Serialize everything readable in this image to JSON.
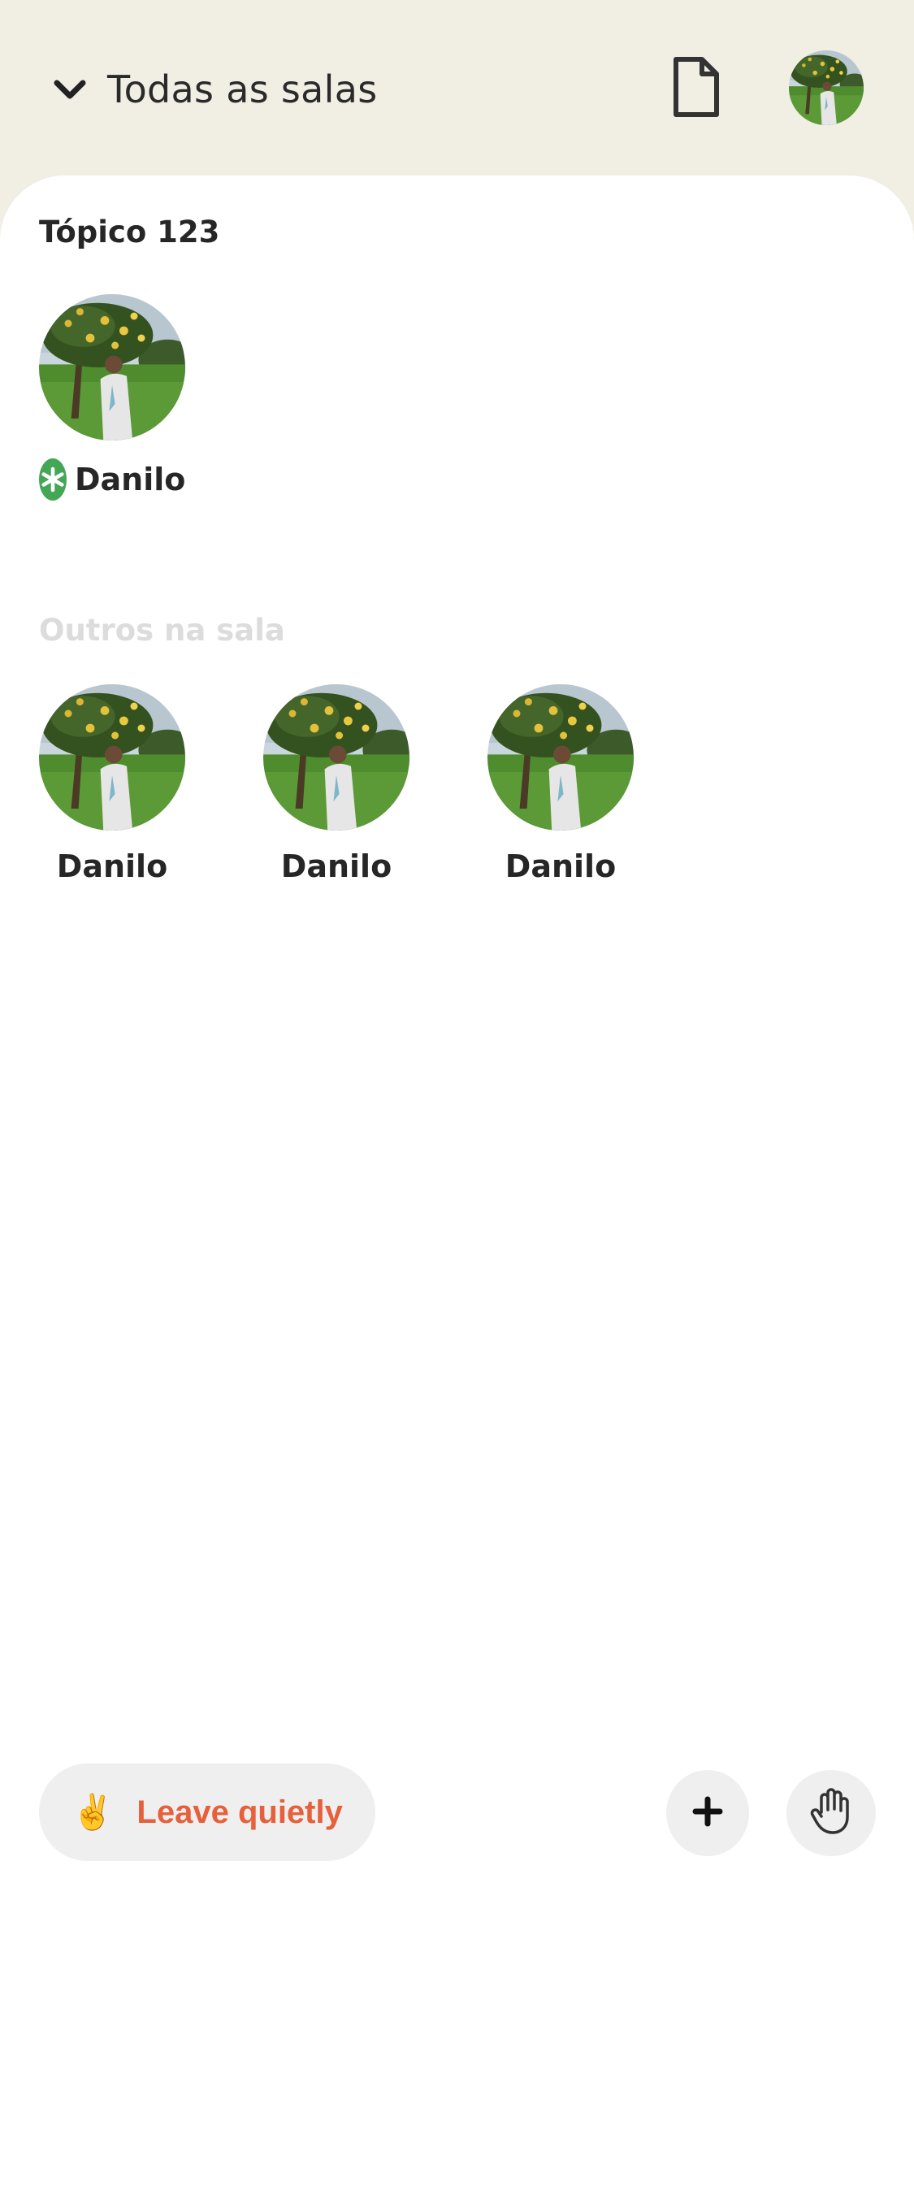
{
  "header": {
    "room_selector_label": "Todas as salas",
    "icons": [
      "chevron-down-icon",
      "document-icon",
      "profile-avatar"
    ]
  },
  "stage": {
    "title": "Tópico 123",
    "speakers": [
      {
        "name": "Danilo",
        "badge": "moderator-asterisk-icon"
      }
    ]
  },
  "audience": {
    "title": "Outros na sala",
    "listeners": [
      {
        "name": "Danilo"
      },
      {
        "name": "Danilo"
      },
      {
        "name": "Danilo"
      }
    ]
  },
  "footer": {
    "leave_emoji": "✌️",
    "leave_label": "Leave quietly",
    "icons": [
      "plus-icon",
      "raise-hand-icon"
    ]
  },
  "colors": {
    "header_bg": "#f1efe4",
    "sheet_bg": "#ffffff",
    "leave_text": "#e5603b",
    "moderator_badge": "#43a756",
    "button_bg": "#efefef"
  }
}
